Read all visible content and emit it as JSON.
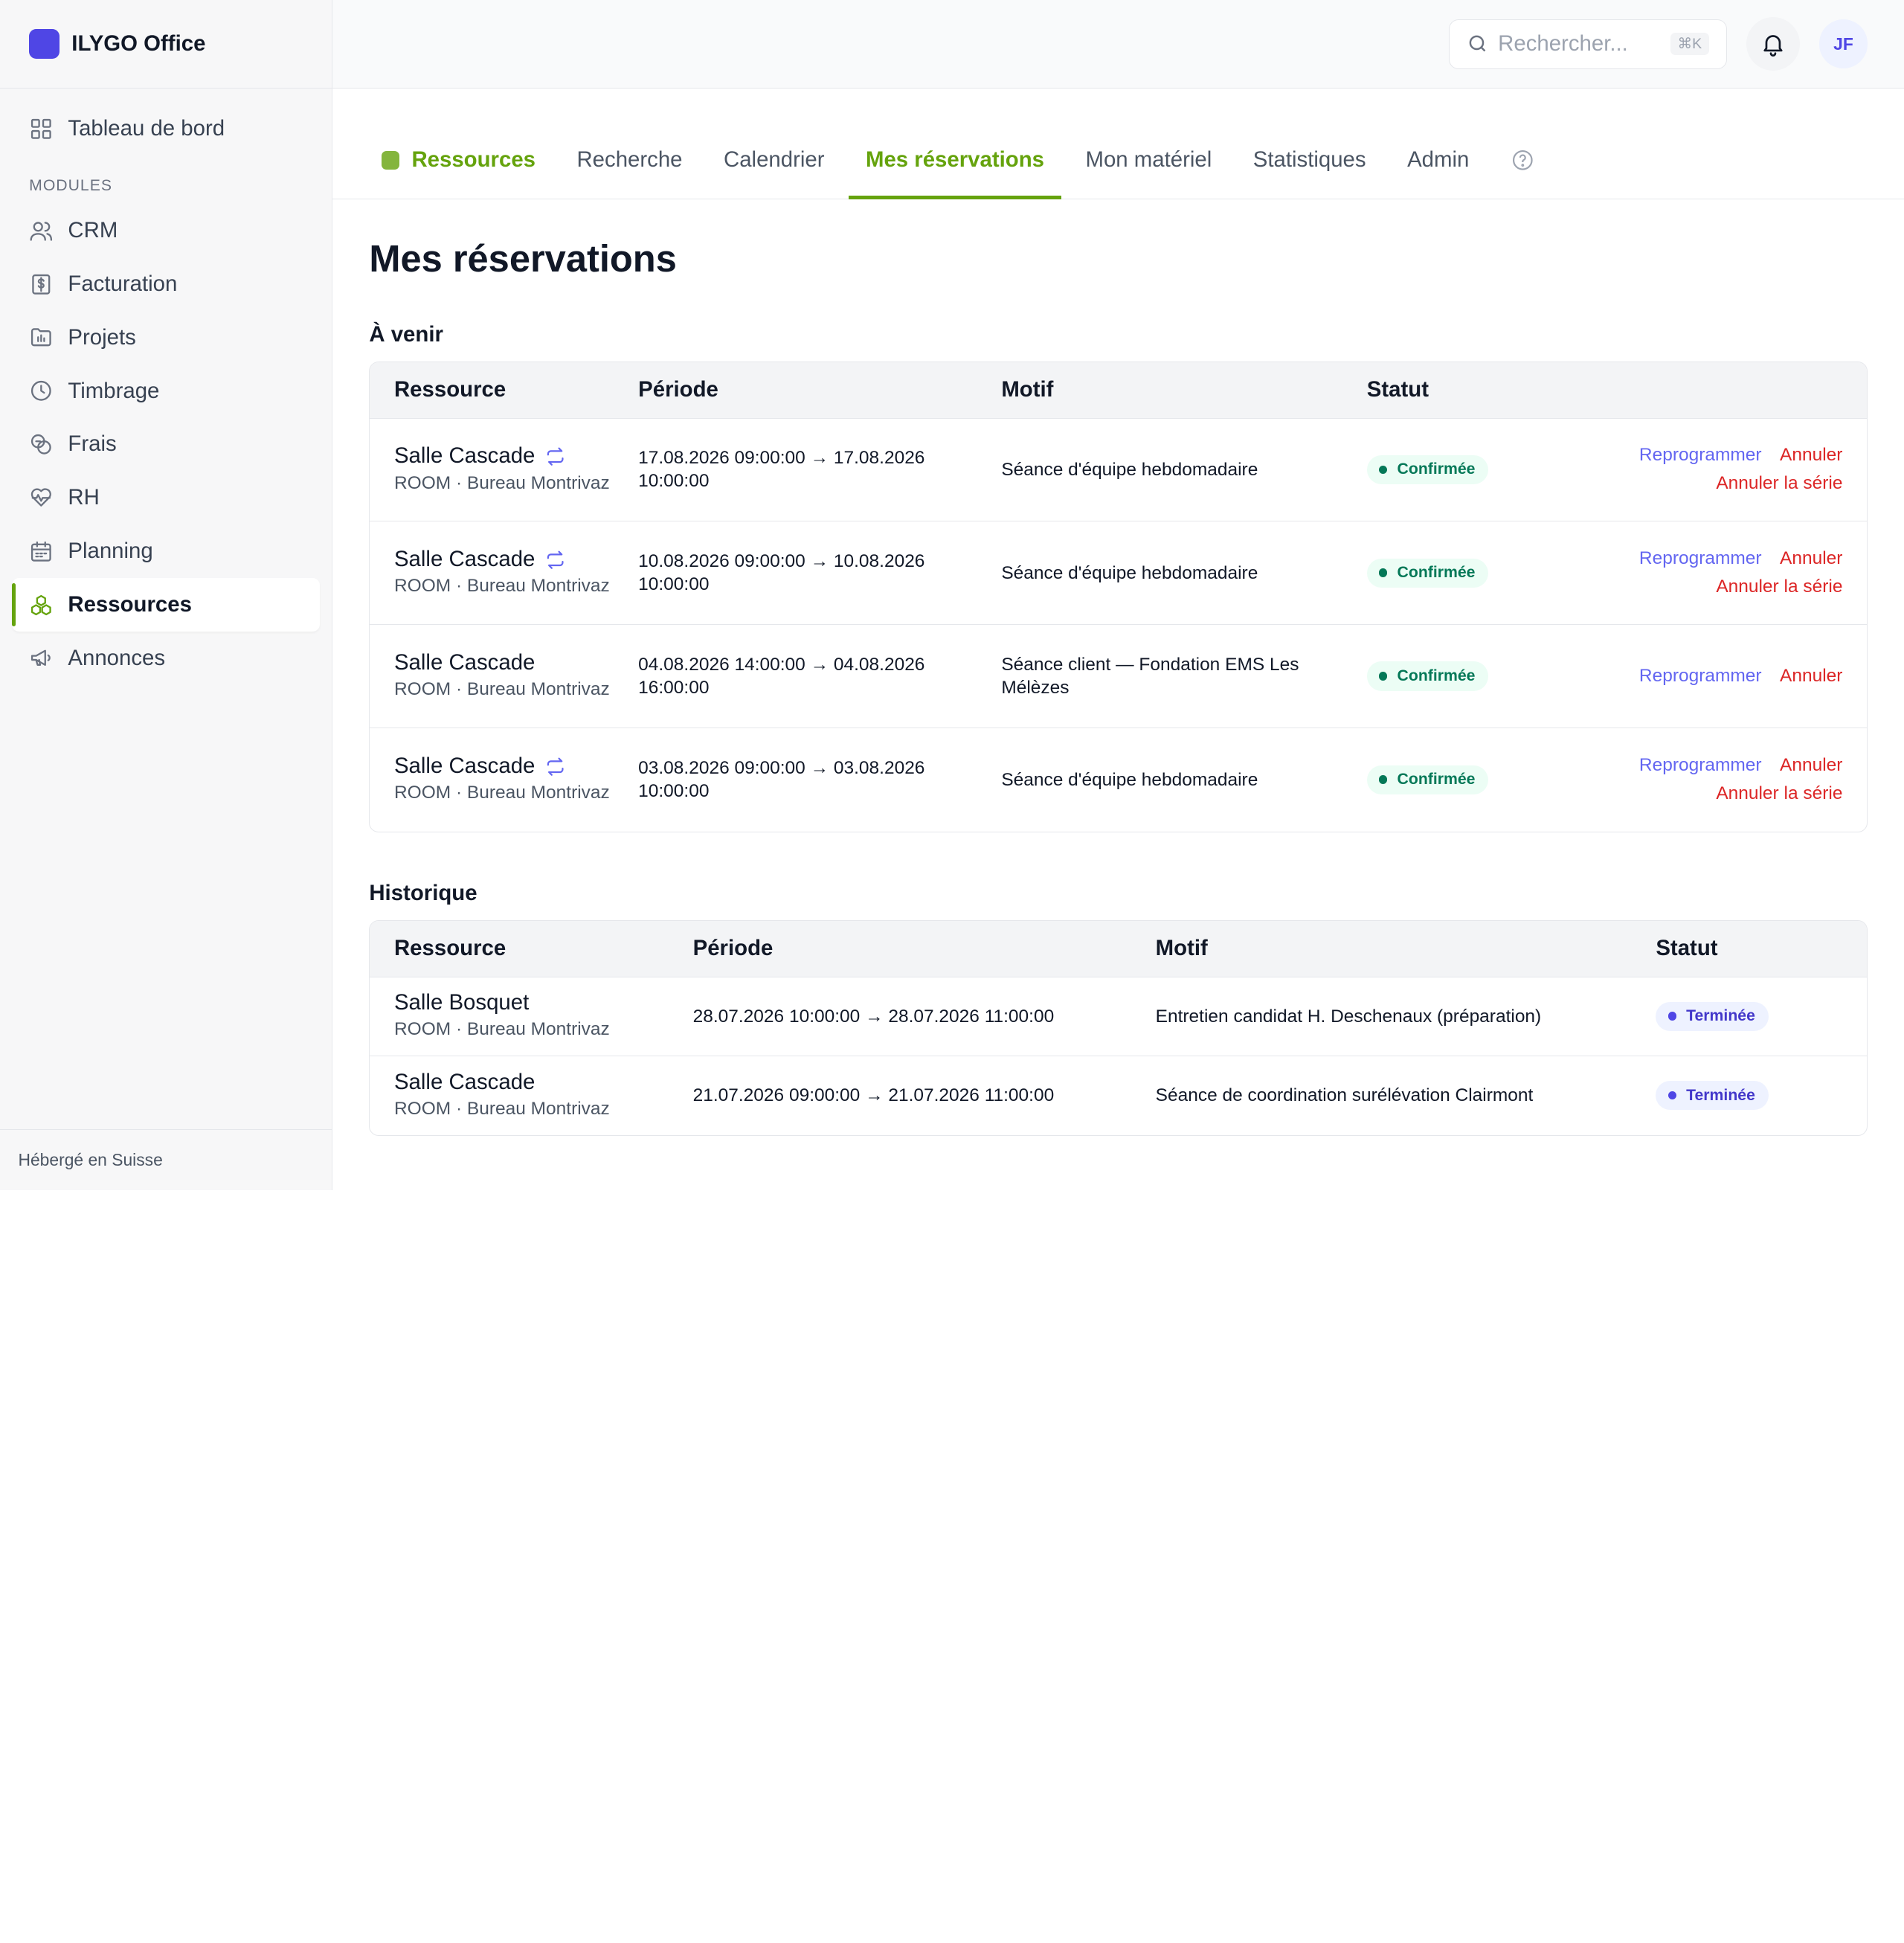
{
  "app": {
    "name": "ILYGO Office"
  },
  "sidebar": {
    "dashboard": {
      "label": "Tableau de bord",
      "icon": "grid-icon"
    },
    "modules_label": "MODULES",
    "items": [
      {
        "label": "CRM",
        "icon": "users-icon"
      },
      {
        "label": "Facturation",
        "icon": "invoice-icon"
      },
      {
        "label": "Projets",
        "icon": "folder-icon"
      },
      {
        "label": "Timbrage",
        "icon": "clock-icon"
      },
      {
        "label": "Frais",
        "icon": "coins-icon"
      },
      {
        "label": "RH",
        "icon": "heart-pulse-icon"
      },
      {
        "label": "Planning",
        "icon": "calendar-icon"
      },
      {
        "label": "Ressources",
        "icon": "boxes-icon",
        "active": true
      },
      {
        "label": "Annonces",
        "icon": "megaphone-icon"
      }
    ],
    "footer": "Hébergé en Suisse"
  },
  "topbar": {
    "search_placeholder": "Rechercher...",
    "shortcut": "⌘K",
    "avatar_initials": "JF"
  },
  "tabs": {
    "brand": "Ressources",
    "items": [
      "Recherche",
      "Calendrier",
      "Mes réservations",
      "Mon matériel",
      "Statistiques",
      "Admin"
    ],
    "active": "Mes réservations"
  },
  "page": {
    "title": "Mes réservations",
    "upcoming_title": "À venir",
    "history_title": "Historique"
  },
  "columns": {
    "resource": "Ressource",
    "period": "Période",
    "motif": "Motif",
    "status": "Statut"
  },
  "actions": {
    "reschedule": "Reprogrammer",
    "cancel": "Annuler",
    "cancel_series": "Annuler la série"
  },
  "upcoming": [
    {
      "name": "Salle Cascade",
      "recurring": true,
      "type": "ROOM · Bureau Montrivaz",
      "period": "17.08.2026 09:00:00 → 17.08.2026 10:00:00",
      "motif": "Séance d'équipe hebdomadaire",
      "status": "Confirmée"
    },
    {
      "name": "Salle Cascade",
      "recurring": true,
      "type": "ROOM · Bureau Montrivaz",
      "period": "10.08.2026 09:00:00 → 10.08.2026 10:00:00",
      "motif": "Séance d'équipe hebdomadaire",
      "status": "Confirmée"
    },
    {
      "name": "Salle Cascade",
      "recurring": false,
      "type": "ROOM · Bureau Montrivaz",
      "period": "04.08.2026 14:00:00 → 04.08.2026 16:00:00",
      "motif": "Séance client — Fondation EMS Les Mélèzes",
      "status": "Confirmée"
    },
    {
      "name": "Salle Cascade",
      "recurring": true,
      "type": "ROOM · Bureau Montrivaz",
      "period": "03.08.2026 09:00:00 → 03.08.2026 10:00:00",
      "motif": "Séance d'équipe hebdomadaire",
      "status": "Confirmée"
    }
  ],
  "history": [
    {
      "name": "Salle Bosquet",
      "type": "ROOM · Bureau Montrivaz",
      "period": "28.07.2026 10:00:00 → 28.07.2026 11:00:00",
      "motif": "Entretien candidat H. Deschenaux (préparation)",
      "status": "Terminée"
    },
    {
      "name": "Salle Cascade",
      "type": "ROOM · Bureau Montrivaz",
      "period": "21.07.2026 09:00:00 → 21.07.2026 11:00:00",
      "motif": "Séance de coordination surélévation Clairmont",
      "status": "Terminée"
    }
  ],
  "colors": {
    "accent": "#65a30d",
    "brand": "#4f46e5",
    "link": "#6366f1",
    "danger": "#dc2626",
    "confirmed": "#047857"
  }
}
